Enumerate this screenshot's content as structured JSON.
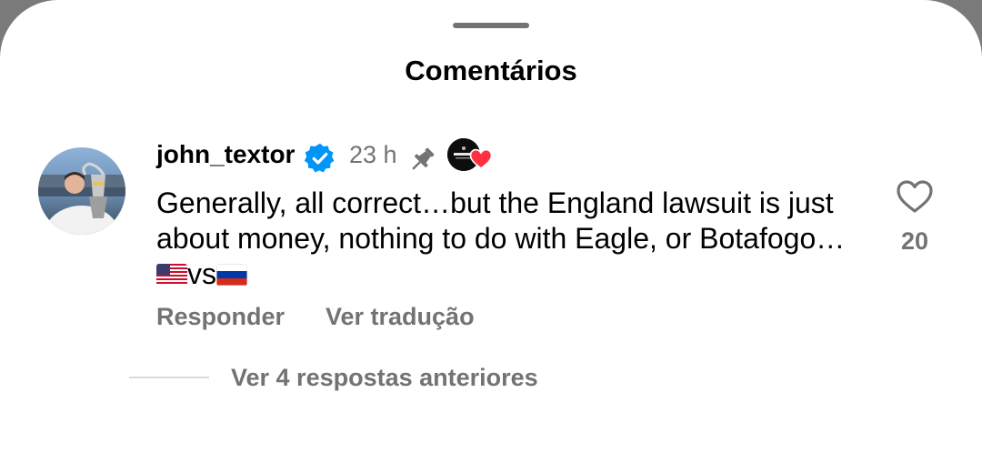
{
  "sheet": {
    "title": "Comentários"
  },
  "comment": {
    "username": "john_textor",
    "timestamp": "23 h",
    "text_before_flags": "Generally, all correct…but the England lawsuit is just about money, nothing to do with Eagle, or Botafogo… ",
    "flag_1": "us-flag",
    "vs": "vs",
    "flag_2": "ru-flag",
    "like_count": "20",
    "actions": {
      "reply": "Responder",
      "translate": "Ver tradução"
    }
  },
  "replies": {
    "link": "Ver 4 respostas anteriores"
  },
  "colors": {
    "verified": "#0095f6",
    "heart": "#ff3040",
    "secondary_text": "#737373"
  },
  "icons": [
    "verified-badge-icon",
    "pin-icon",
    "heart-outline-icon",
    "heart-filled-icon"
  ]
}
